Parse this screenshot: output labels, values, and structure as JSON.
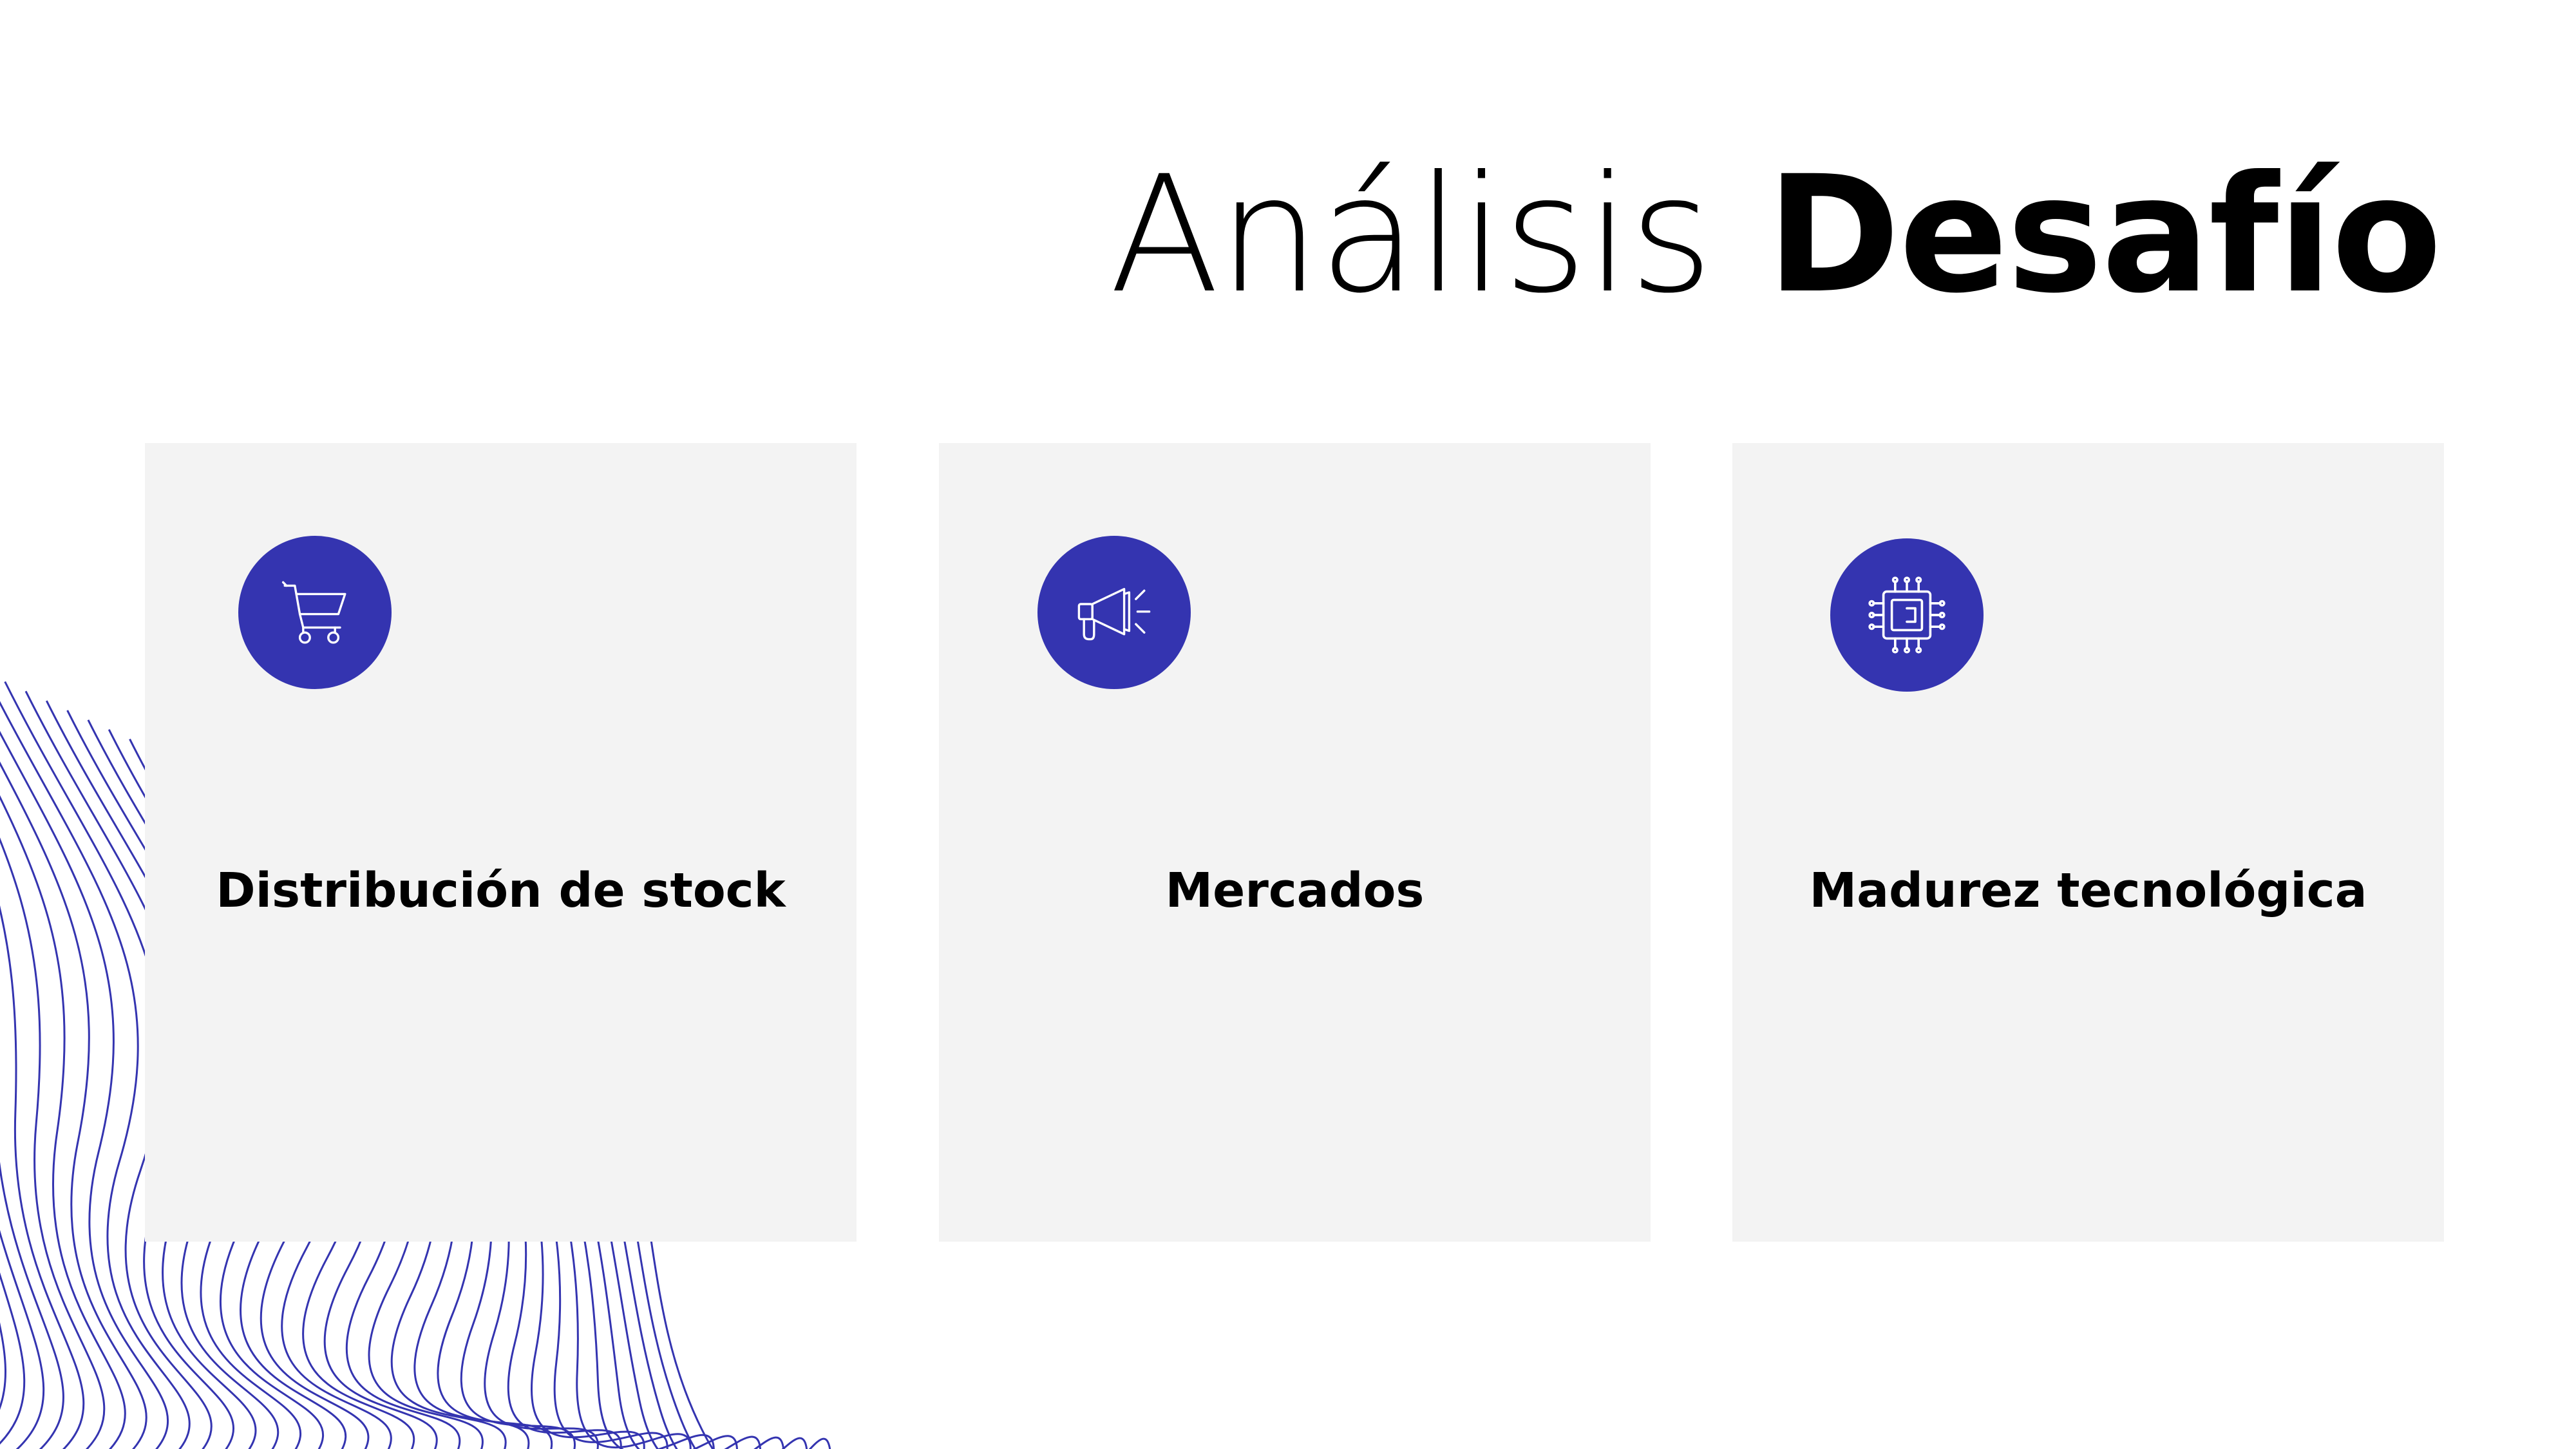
{
  "title": {
    "light": "Análisis",
    "bold": "Desafío"
  },
  "cards": [
    {
      "label": "Distribución de stock",
      "icon": "shopping-cart-icon"
    },
    {
      "label": "Mercados",
      "icon": "megaphone-icon"
    },
    {
      "label": "Madurez tecnológica",
      "icon": "cpu-chip-icon"
    }
  ],
  "colors": {
    "accent": "#3434b0",
    "card_background": "#f3f3f3",
    "text": "#000000",
    "wave_lines": "#3434b0"
  }
}
